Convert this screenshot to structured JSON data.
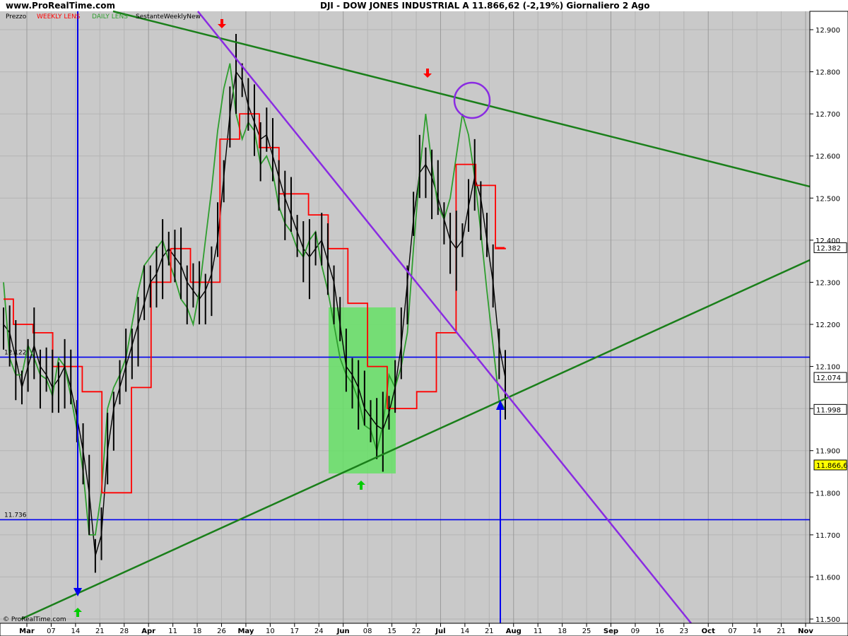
{
  "header": {
    "site": "www.ProRealTime.com",
    "title": "DJI - DOW JONES INDUSTRIAL A    11.866,62 (-2,19%)    Giornaliero  2 Ago"
  },
  "legend": {
    "prezzo": "Prezzo",
    "weekly": "WEEKLY LENS",
    "daily": "DAILY LENS",
    "sest": "SestanteWeeklyNew"
  },
  "copyright": "© ProRealTime.com",
  "colors": {
    "background": "#c9c9c9",
    "price": "#000000",
    "weekly": "#ff0000",
    "daily": "#2e9e2e",
    "trend_green": "#1a7f1a",
    "trend_purple": "#8a2be2",
    "hline": "#0000ee",
    "highlight": "#66e066"
  },
  "chart_data": {
    "type": "line",
    "ylim": [
      11500,
      12950
    ],
    "yticks": [
      "12.900",
      "12.800",
      "12.700",
      "12.600",
      "12.500",
      "12.400",
      "12.300",
      "12.200",
      "12.100",
      "12.000",
      "11.900",
      "11.800",
      "11.700",
      "11.600",
      "11.500"
    ],
    "ytick_values": [
      12900,
      12800,
      12700,
      12600,
      12500,
      12400,
      12300,
      12200,
      12100,
      12000,
      11900,
      11800,
      11700,
      11600,
      11500
    ],
    "xticks": [
      "Mar",
      "07",
      "14",
      "21",
      "28",
      "Apr",
      "11",
      "18",
      "26",
      "May",
      "10",
      "17",
      "24",
      "Jun",
      "08",
      "15",
      "22",
      "Jul",
      "14",
      "21",
      "Aug",
      "11",
      "18",
      "25",
      "Sep",
      "09",
      "16",
      "23",
      "Oct",
      "07",
      "14",
      "21",
      "Nov"
    ],
    "month_labels": [
      "Mar",
      "Apr",
      "May",
      "Jun",
      "Jul",
      "Aug",
      "Sep",
      "Oct",
      "Nov"
    ],
    "hlines": [
      {
        "label": "12.122",
        "value": 12122
      },
      {
        "label": "11.736",
        "value": 11736
      }
    ],
    "right_labels": [
      {
        "text": "12.382",
        "value": 12382,
        "color": "#ff0000"
      },
      {
        "text": "12.074",
        "value": 12074,
        "color": "#000000"
      },
      {
        "text": "11.998",
        "value": 11998,
        "color": "#2e9e2e"
      },
      {
        "text": "11.866,6",
        "value": 11866,
        "color": "#000000",
        "bg": "#ffff00"
      }
    ],
    "series": [
      {
        "color": "#000000",
        "values": [
          12200,
          12180,
          12120,
          12050,
          12100,
          12150,
          12100,
          12080,
          12050,
          12070,
          12100,
          12050,
          11980,
          11900,
          11800,
          11650,
          11700,
          11900,
          12000,
          12050,
          12100,
          12150,
          12200,
          12250,
          12300,
          12320,
          12360,
          12380,
          12360,
          12340,
          12300,
          12280,
          12260,
          12280,
          12320,
          12400,
          12550,
          12700,
          12800,
          12780,
          12720,
          12680,
          12640,
          12650,
          12600,
          12550,
          12500,
          12460,
          12420,
          12380,
          12360,
          12380,
          12400,
          12350,
          12300,
          12200,
          12100,
          12080,
          12050,
          12000,
          11980,
          11960,
          11950,
          11990,
          12050,
          12150,
          12300,
          12450,
          12560,
          12580,
          12550,
          12500,
          12450,
          12400,
          12380,
          12400,
          12480,
          12550,
          12500,
          12400,
          12300,
          12150,
          12074
        ]
      },
      {
        "color": "#2e9e2e",
        "values": [
          12300,
          12120,
          12080,
          12080,
          12150,
          12120,
          12080,
          12070,
          12030,
          12120,
          12100,
          12030,
          11950,
          11850,
          11700,
          11700,
          11800,
          12000,
          12050,
          12080,
          12120,
          12200,
          12280,
          12340,
          12360,
          12380,
          12400,
          12350,
          12310,
          12260,
          12240,
          12200,
          12280,
          12400,
          12520,
          12660,
          12760,
          12820,
          12700,
          12640,
          12680,
          12660,
          12580,
          12600,
          12560,
          12480,
          12440,
          12420,
          12380,
          12360,
          12400,
          12420,
          12340,
          12280,
          12200,
          12120,
          12080,
          12060,
          12020,
          11960,
          11950,
          11900,
          11960,
          12080,
          12050,
          12100,
          12180,
          12380,
          12560,
          12700,
          12580,
          12480,
          12450,
          12500,
          12600,
          12700,
          12650,
          12550,
          12420,
          12280,
          12150,
          12020,
          11998
        ]
      },
      {
        "color": "#ff0000",
        "step": true,
        "values": [
          12260,
          12200,
          12200,
          12180,
          12180,
          12100,
          12100,
          12100,
          12040,
          12040,
          11800,
          11800,
          11800,
          12050,
          12050,
          12300,
          12300,
          12380,
          12380,
          12300,
          12300,
          12300,
          12640,
          12640,
          12700,
          12700,
          12620,
          12620,
          12510,
          12510,
          12510,
          12460,
          12460,
          12380,
          12380,
          12250,
          12250,
          12100,
          12100,
          12000,
          12000,
          12000,
          12040,
          12040,
          12180,
          12180,
          12580,
          12580,
          12530,
          12530,
          12380,
          12382
        ]
      }
    ]
  }
}
